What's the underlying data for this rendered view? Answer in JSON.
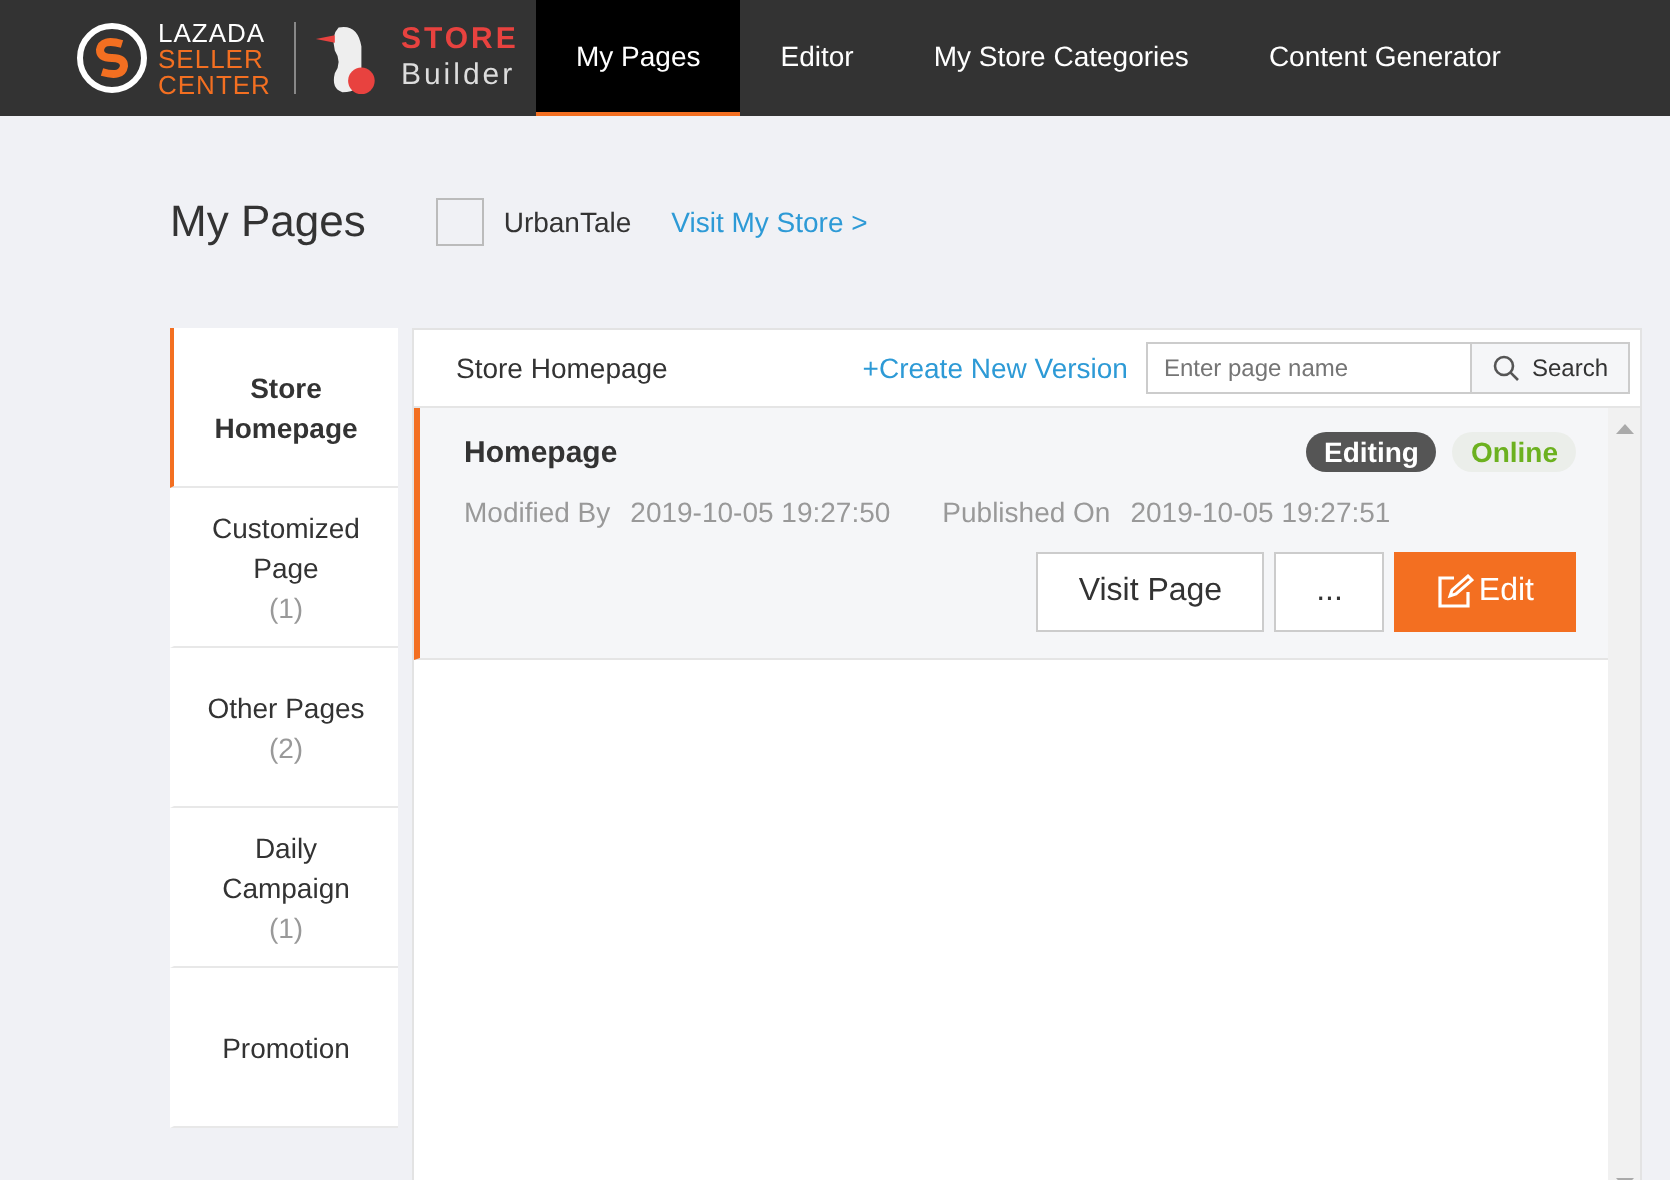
{
  "logo": {
    "line_1": "LAZADA",
    "line_2": "SELLER",
    "line_3": "CENTER",
    "product_1": "STORE",
    "product_2": "Builder"
  },
  "nav": [
    {
      "label": "My Pages",
      "selected": true
    },
    {
      "label": "Editor",
      "selected": false
    },
    {
      "label": "My Store Categories",
      "selected": false
    },
    {
      "label": "Content Generator",
      "selected": false
    }
  ],
  "page_title": "My Pages",
  "store_name": "UrbanTale",
  "visit_store": "Visit My Store >",
  "sidebar": [
    {
      "label": "Store Homepage",
      "selected": true
    },
    {
      "label": "Customized Page",
      "count": "(1)",
      "selected": false
    },
    {
      "label": "Other Pages",
      "count": "(2)",
      "selected": false
    },
    {
      "label": "Daily Campaign",
      "count": "(1)",
      "selected": false
    },
    {
      "label": "Promotion",
      "selected": false
    }
  ],
  "toolbar": {
    "section": "Store Homepage",
    "create": "+Create New Version",
    "search_placeholder": "Enter page name",
    "search_button": "Search"
  },
  "pages": [
    {
      "title": "Homepage",
      "badges": [
        {
          "label": "Editing",
          "kind": "editing"
        },
        {
          "label": "Online",
          "kind": "online"
        }
      ],
      "modified_label": "Modified By",
      "modified": "2019-10-05 19:27:50",
      "published_label": "Published On",
      "published": "2019-10-05 19:27:51",
      "buttons": [
        {
          "label": "Visit Page",
          "kind": "plain"
        },
        {
          "label": "...",
          "kind": "plain"
        },
        {
          "label": "Edit",
          "kind": "primary"
        }
      ]
    }
  ]
}
